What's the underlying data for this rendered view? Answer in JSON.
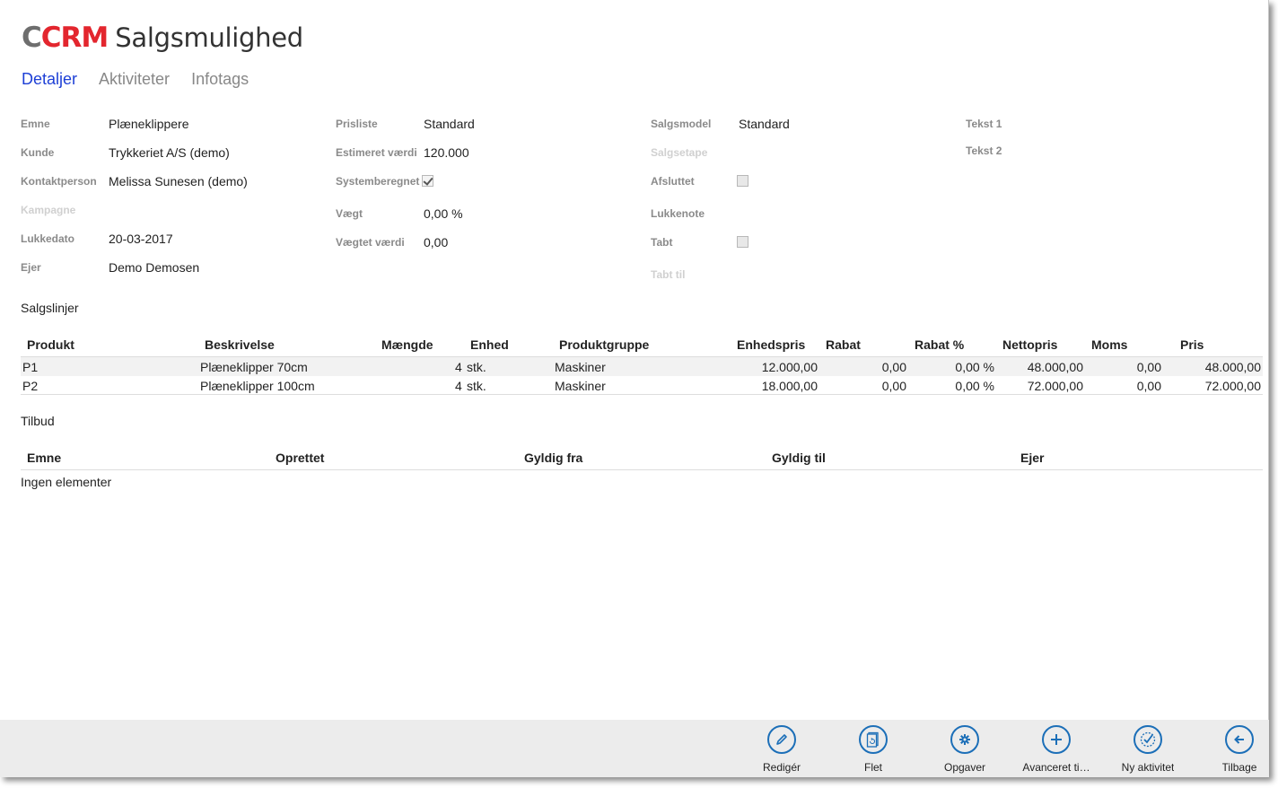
{
  "app": {
    "logo_part1": "C",
    "logo_part2": "CRM",
    "title": "Salgsmulighed"
  },
  "tabs": [
    {
      "label": "Detaljer",
      "active": true
    },
    {
      "label": "Aktiviteter",
      "active": false
    },
    {
      "label": "Infotags",
      "active": false
    }
  ],
  "details": {
    "col1": {
      "emne": {
        "label": "Emne",
        "value": "Plæneklippere"
      },
      "kunde": {
        "label": "Kunde",
        "value": "Trykkeriet A/S (demo)"
      },
      "kontaktperson": {
        "label": "Kontaktperson",
        "value": "Melissa Sunesen (demo)"
      },
      "kampagne": {
        "label": "Kampagne",
        "value": ""
      },
      "lukkedato": {
        "label": "Lukkedato",
        "value": "20-03-2017"
      },
      "ejer": {
        "label": "Ejer",
        "value": "Demo Demosen"
      }
    },
    "col2": {
      "prisliste": {
        "label": "Prisliste",
        "value": "Standard"
      },
      "estimeret": {
        "label": "Estimeret værdi",
        "value": "120.000"
      },
      "systemberegnet": {
        "label": "Systemberegnet",
        "checked": true
      },
      "vaegt": {
        "label": "Vægt",
        "value": "0,00 %"
      },
      "vaegtet": {
        "label": "Vægtet værdi",
        "value": "0,00"
      }
    },
    "col3": {
      "salgsmodel": {
        "label": "Salgsmodel",
        "value": "Standard"
      },
      "salgsetape": {
        "label": "Salgsetape",
        "value": ""
      },
      "afsluttet": {
        "label": "Afsluttet",
        "checked": false
      },
      "lukkenote": {
        "label": "Lukkenote",
        "value": ""
      },
      "tabt": {
        "label": "Tabt",
        "checked": false
      },
      "tabt_til": {
        "label": "Tabt til",
        "value": ""
      }
    },
    "col4": {
      "tekst1": {
        "label": "Tekst 1",
        "value": ""
      },
      "tekst2": {
        "label": "Tekst 2",
        "value": ""
      }
    }
  },
  "salgslinjer": {
    "title": "Salgslinjer",
    "columns": [
      "Produkt",
      "Beskrivelse",
      "Mængde",
      "Enhed",
      "Produktgruppe",
      "Enhedspris",
      "Rabat",
      "Rabat %",
      "Nettopris",
      "Moms",
      "Pris"
    ],
    "rows": [
      {
        "produkt": "P1",
        "beskrivelse": "Plæneklipper 70cm",
        "maengde": "4",
        "enhed": "stk.",
        "produktgruppe": "Maskiner",
        "enhedspris": "12.000,00",
        "rabat": "0,00",
        "rabat_pct": "0,00 %",
        "nettopris": "48.000,00",
        "moms": "0,00",
        "pris": "48.000,00"
      },
      {
        "produkt": "P2",
        "beskrivelse": "Plæneklipper 100cm",
        "maengde": "4",
        "enhed": "stk.",
        "produktgruppe": "Maskiner",
        "enhedspris": "18.000,00",
        "rabat": "0,00",
        "rabat_pct": "0,00 %",
        "nettopris": "72.000,00",
        "moms": "0,00",
        "pris": "72.000,00"
      }
    ]
  },
  "tilbud": {
    "title": "Tilbud",
    "columns": [
      "Emne",
      "Oprettet",
      "Gyldig fra",
      "Gyldig til",
      "Ejer"
    ],
    "empty_text": "Ingen elementer"
  },
  "appbar": {
    "buttons": [
      {
        "label": "Redigér",
        "icon": "pencil-icon"
      },
      {
        "label": "Flet",
        "icon": "document-merge-icon"
      },
      {
        "label": "Opgaver",
        "icon": "gear-icon"
      },
      {
        "label": "Avanceret ti…",
        "icon": "plus-icon"
      },
      {
        "label": "Ny aktivitet",
        "icon": "checklist-icon"
      },
      {
        "label": "Tilbage",
        "icon": "back-arrow-icon"
      }
    ]
  },
  "colors": {
    "accent": "#1c6fb8",
    "tab_active": "#1d3fd6",
    "logo_red": "#e3262e",
    "logo_gray": "#6e6e6e"
  }
}
